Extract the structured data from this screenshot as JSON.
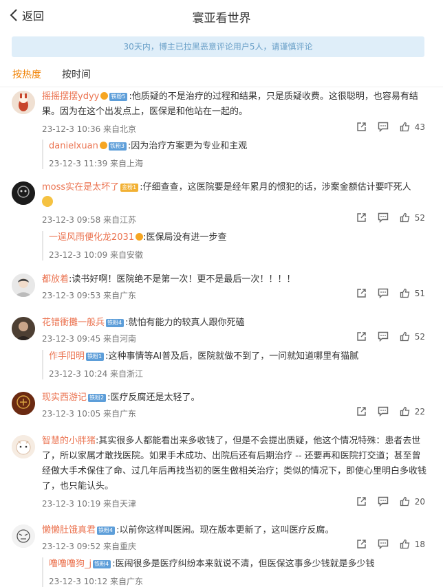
{
  "header": {
    "back_label": "返回",
    "title": "寰亚看世界"
  },
  "notice": "30天内，博主已拉黑恶意评论用户5人，请谨慎评论",
  "sort": {
    "hot": "按热度",
    "time": "按时间"
  },
  "comments": [
    {
      "user": "摇摇摆摆ydyy",
      "badge": "铁粉5",
      "text": ":他质疑的不是治疗的过程和结果，只是质疑收费。这很聪明，也容易有结果。因为在这个出发点上，医保是和他站在一起的。",
      "meta": "23-12-3 10:36 来自北京",
      "likes": "43",
      "reply": {
        "user": "danielxuan",
        "badge": "铁粉3",
        "text": ":因为治疗方案更为专业和主观",
        "meta": "23-12-3 11:39 来自上海"
      }
    },
    {
      "user": "moss实在是太坏了",
      "badge": "金粉1",
      "text": ":仔细查查，这医院要是经年累月的惯犯的话，涉案金额估计要吓死人",
      "meta": "23-12-3 09:58 来自江苏",
      "likes": "52",
      "reply": {
        "user": "一逞风雨便化龙2031",
        "text": ":医保局没有进一步查",
        "meta": "23-12-3 10:09 来自安徽"
      }
    },
    {
      "user": "都放着",
      "text": ":读书好啊！医院绝不是第一次！更不是最后一次！！！！",
      "meta": "23-12-3 09:53 来自广东",
      "likes": "51"
    },
    {
      "user": "花错衝攤一般兵",
      "badge": "铁粉4",
      "text": ":就怕有能力的较真人跟你死磕",
      "meta": "23-12-3 09:45 来自河南",
      "likes": "52",
      "reply": {
        "user": "作手阳明",
        "badge": "铁粉1",
        "text": ":这种事情等AI普及后，医院就做不到了，一问就知道哪里有猫腻",
        "meta": "23-12-3 10:24 来自浙江"
      }
    },
    {
      "user": "现实西游记",
      "badge": "铁粉2",
      "text": ":医疗反腐还是太轻了。",
      "meta": "23-12-3 10:05 来自广东",
      "likes": "22"
    },
    {
      "user": "智慧的小胖猪",
      "text": ":其实很多人都能看出来多收钱了，但是不会提出质疑，他这个情况特殊：患者去世了，所以家属才敢找医院。如果手术成功、出院后还有后期治疗 -- 还要再和医院打交道；甚至曾经做大手术保住了命、过几年后再找当初的医生做相关治疗；类似的情况下，即使心里明白多收钱了，也只能认头。",
      "meta": "23-12-3 10:19 来自天津",
      "likes": "20"
    },
    {
      "user": "懒懒肚饿真君",
      "badge": "铁粉4",
      "text": ":以前你这样叫医闹。现在版本更新了，这叫医疗反腐。",
      "meta": "23-12-3 09:52 来自重庆",
      "likes": "18",
      "reply": {
        "user": "噜噜噜狗_j",
        "badge": "铁粉4",
        "text": ":医闹很多是医疗纠纷本来就说不清，但医保这事多少钱就是多少钱",
        "meta": "23-12-3 10:12 来自广东"
      }
    }
  ],
  "colors": {
    "accent": "#f08000",
    "username": "#eb7350",
    "notice_bg": "#dfeef9"
  }
}
